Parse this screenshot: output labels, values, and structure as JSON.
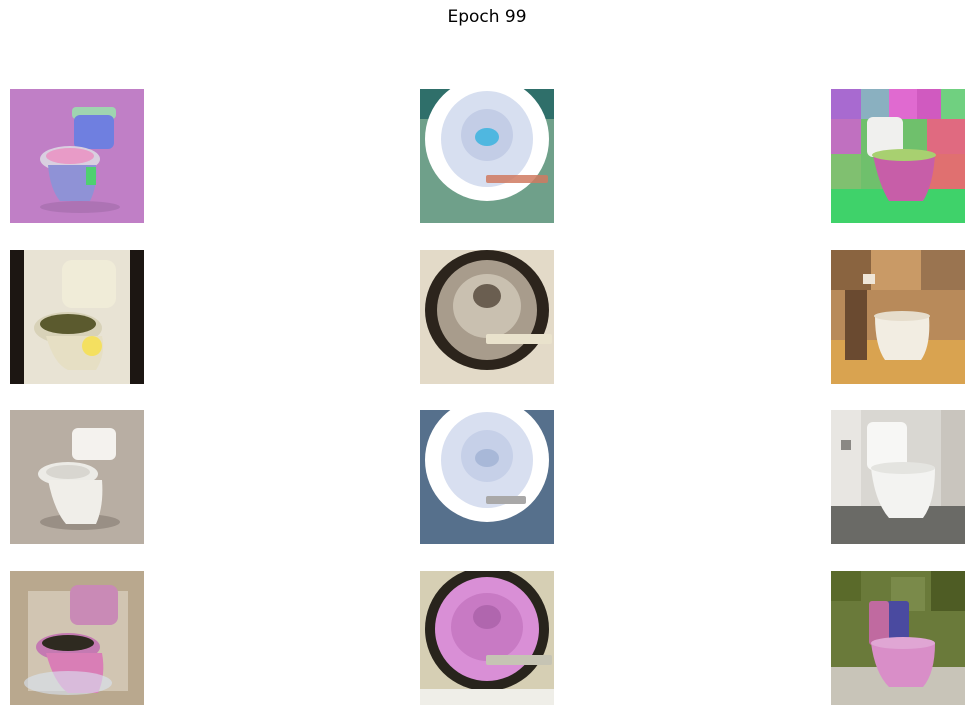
{
  "figure": {
    "title": "Epoch 99"
  },
  "grid": {
    "rows": 4,
    "columns": 3,
    "images": [
      {
        "depicts": "toilet-colorful-render",
        "colors": {
          "bg": "#c07fc6",
          "tank": "#6f7fe0",
          "bowl": "#c9c3d8",
          "base": "#8f92d6"
        }
      },
      {
        "depicts": "toilet-bowl-topdown",
        "colors": {
          "bg": "#6fa08a",
          "rim": "#ffffff",
          "inner": "#c6d2ea",
          "water": "#4fb7e0"
        }
      },
      {
        "depicts": "toilet-patchwork-bathroom",
        "colors": {
          "wall1": "#cc6ed6",
          "wall2": "#6fc06c",
          "floor": "#3fd26a",
          "body": "#c75ea8"
        }
      },
      {
        "depicts": "toilet-sepia-render",
        "colors": {
          "bg": "#e8e3d4",
          "edge": "#1c1612",
          "body": "#f0ecd8",
          "seat": "#5b5a2e"
        }
      },
      {
        "depicts": "toilet-bowl-dark-rim",
        "colors": {
          "bg": "#e3dac8",
          "rim": "#2c241c",
          "inner": "#c9c0b0"
        }
      },
      {
        "depicts": "toilet-warm-bathroom",
        "colors": {
          "wall": "#b88a5a",
          "floor": "#d9a350",
          "body": "#f2ede2"
        }
      },
      {
        "depicts": "toilet-white-render",
        "colors": {
          "bg": "#b8aea3",
          "body": "#f4f2ee",
          "shadow": "#8c8278"
        }
      },
      {
        "depicts": "toilet-bowl-topdown-blue",
        "colors": {
          "bg": "#56708c",
          "rim": "#ffffff",
          "inner": "#c6d0e8"
        }
      },
      {
        "depicts": "toilet-marble-bathroom",
        "colors": {
          "wall": "#d9d7d2",
          "floor": "#6a6a66",
          "body": "#f7f7f5"
        }
      },
      {
        "depicts": "toilet-pink-artifact",
        "colors": {
          "bg": "#b9a88e",
          "body": "#d97eb6",
          "seat": "#2e2a20"
        }
      },
      {
        "depicts": "toilet-bowl-pink",
        "colors": {
          "bg": "#d6cfb4",
          "rim": "#28241c",
          "inner": "#d98fd6"
        }
      },
      {
        "depicts": "toilet-pink-bathroom",
        "colors": {
          "wall": "#6a7a3a",
          "floor": "#c8c4b8",
          "body": "#d98ec8",
          "tank": "#4a4aa0"
        }
      }
    ]
  }
}
